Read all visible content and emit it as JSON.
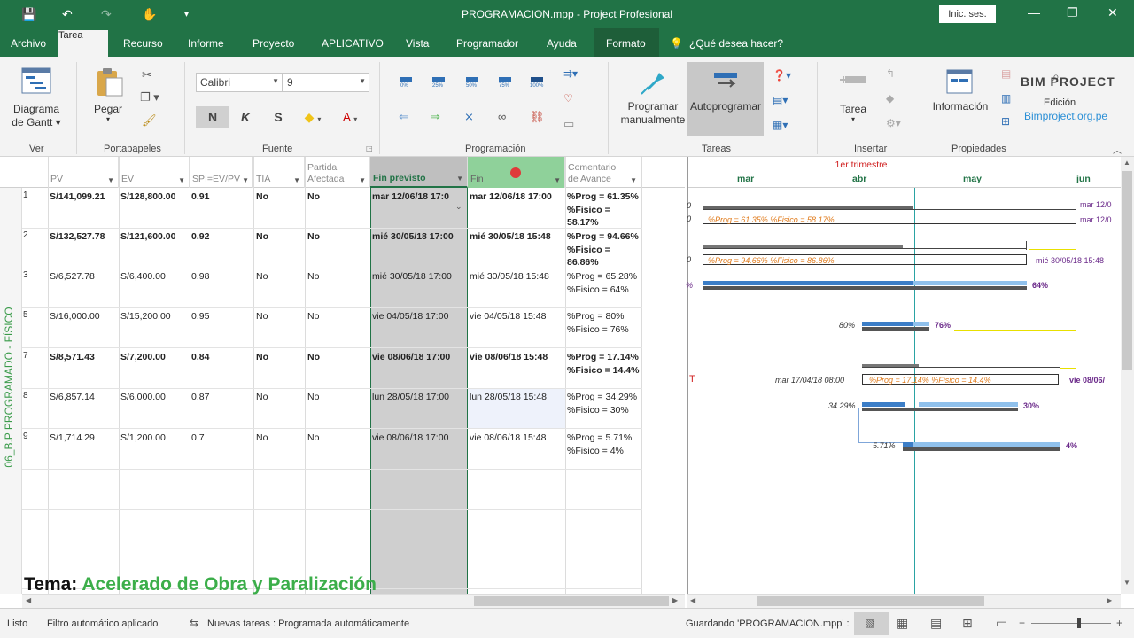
{
  "window": {
    "title": "PROGRAMACION.mpp  -  Project Profesional",
    "signin": "Inic. ses.",
    "min": "—",
    "max": "❐",
    "close": "✕"
  },
  "quick_access": {
    "save": "💾",
    "undo": "↶",
    "redo": "↷",
    "touch": "✋",
    "customize": "▾"
  },
  "menu": {
    "items": [
      "Archivo",
      "Tarea",
      "Recurso",
      "Informe",
      "Proyecto",
      "APLICATIVO",
      "Vista",
      "Programador",
      "Ayuda",
      "Formato"
    ],
    "active": "Tarea",
    "tellme": "¿Qué desea hacer?"
  },
  "ribbon": {
    "groups": [
      "Ver",
      "Portapapeles",
      "Fuente",
      "Programación",
      "Tareas",
      "Insertar",
      "Propiedades"
    ],
    "gantt_label_1": "Diagrama",
    "gantt_label_2": "de Gantt",
    "paste": "Pegar",
    "font_name": "Calibri",
    "font_size": "9",
    "bold": "N",
    "italic": "K",
    "underline": "S",
    "highlight": "◆",
    "fontcolor": "A",
    "percent_labels": [
      "0%",
      "25%",
      "50%",
      "75%",
      "100%"
    ],
    "manual_1": "Programar",
    "manual_2": "manualmente",
    "auto": "Autoprogramar",
    "task": "Tarea",
    "info": "Información",
    "details": "Edición",
    "watermark_top": "BIM PROJECT",
    "watermark_bottom": "Bimproject.org.pe"
  },
  "side_label": "06_B.P PROGRAMADO - FÍSICO",
  "table": {
    "headers": [
      "PV",
      "EV",
      "SPI=EV/PV",
      "TIA",
      "Partida Afectada",
      "Fin previsto",
      "Fin",
      "Comentario de Avance"
    ],
    "rows": [
      {
        "id": "1",
        "pv": "S/141,099.21",
        "ev": "S/128,800.00",
        "spi": "0.91",
        "tia": "No",
        "afectada": "No",
        "fin_prev": "mar 12/06/18 17:0",
        "fin": "mar 12/06/18 17:00",
        "c1": "%Prog = 61.35%",
        "c2": "%Fisico =",
        "c3": "58.17%",
        "bold": true
      },
      {
        "id": "2",
        "pv": "S/132,527.78",
        "ev": "S/121,600.00",
        "spi": "0.92",
        "tia": "No",
        "afectada": "No",
        "fin_prev": "mié 30/05/18 17:00",
        "fin": "mié 30/05/18 15:48",
        "c1": "%Prog = 94.66%",
        "c2": "%Fisico =",
        "c3": "86.86%",
        "bold": true
      },
      {
        "id": "3",
        "pv": "S/6,527.78",
        "ev": "S/6,400.00",
        "spi": "0.98",
        "tia": "No",
        "afectada": "No",
        "fin_prev": "mié 30/05/18 17:00",
        "fin": "mié 30/05/18 15:48",
        "c1": "%Prog = 65.28%",
        "c2": "%Fisico = 64%",
        "c3": "",
        "bold": false
      },
      {
        "id": "5",
        "pv": "S/16,000.00",
        "ev": "S/15,200.00",
        "spi": "0.95",
        "tia": "No",
        "afectada": "No",
        "fin_prev": "vie 04/05/18 17:00",
        "fin": "vie 04/05/18 15:48",
        "c1": "%Prog = 80%",
        "c2": "%Fisico = 76%",
        "c3": "",
        "bold": false
      },
      {
        "id": "7",
        "pv": "S/8,571.43",
        "ev": "S/7,200.00",
        "spi": "0.84",
        "tia": "No",
        "afectada": "No",
        "fin_prev": "vie 08/06/18 17:00",
        "fin": "vie 08/06/18 15:48",
        "c1": "%Prog = 17.14%",
        "c2": "%Fisico = 14.4%",
        "c3": "",
        "bold": true
      },
      {
        "id": "8",
        "pv": "S/6,857.14",
        "ev": "S/6,000.00",
        "spi": "0.87",
        "tia": "No",
        "afectada": "No",
        "fin_prev": "lun 28/05/18 17:00",
        "fin": "lun 28/05/18 15:48",
        "c1": "%Prog = 34.29%",
        "c2": "%Fisico = 30%",
        "c3": "",
        "bold": false
      },
      {
        "id": "9",
        "pv": "S/1,714.29",
        "ev": "S/1,200.00",
        "spi": "0.7",
        "tia": "No",
        "afectada": "No",
        "fin_prev": "vie 08/06/18 17:00",
        "fin": "vie 08/06/18 15:48",
        "c1": "%Prog = 5.71%",
        "c2": "%Fisico = 4%",
        "c3": "",
        "bold": false
      }
    ]
  },
  "gantt": {
    "quarter": "1er trimestre",
    "months": [
      "mar",
      "abr",
      "may",
      "jun"
    ],
    "labels": {
      "r1_date_a": "mar 12/0",
      "r1_prog": "%Prog = 61.35%  %Fisico = 58.17%",
      "r1_date_b": "mar 12/0",
      "r2_prog": "%Prog = 94.66%  %Fisico = 86.86%",
      "r2_date": "mié 30/05/18 15:48",
      "r3_pct": "64%",
      "r3_left": "%",
      "r5_left": "80%",
      "r5_right": "76%",
      "r7_date": "mar 17/04/18 08:00",
      "r7_prog": "%Prog = 17.14%  %Fisico = 14.4%",
      "r7_end": "vie 08/06/",
      "r8_left": "34.29%",
      "r8_right": "30%",
      "r9_left": "5.71%",
      "r9_right": "4%",
      "marker": "T",
      "zero_a": "0",
      "zero_b": "0",
      "zero_c": "0"
    }
  },
  "overlay": {
    "label": "Tema:",
    "title": "Acelerado de Obra y Paralización"
  },
  "status": {
    "ready": "Listo",
    "filter": "Filtro automático aplicado",
    "new_tasks": "Nuevas tareas : Programada automáticamente",
    "saving": "Guardando 'PROGRAMACION.mpp' :"
  }
}
